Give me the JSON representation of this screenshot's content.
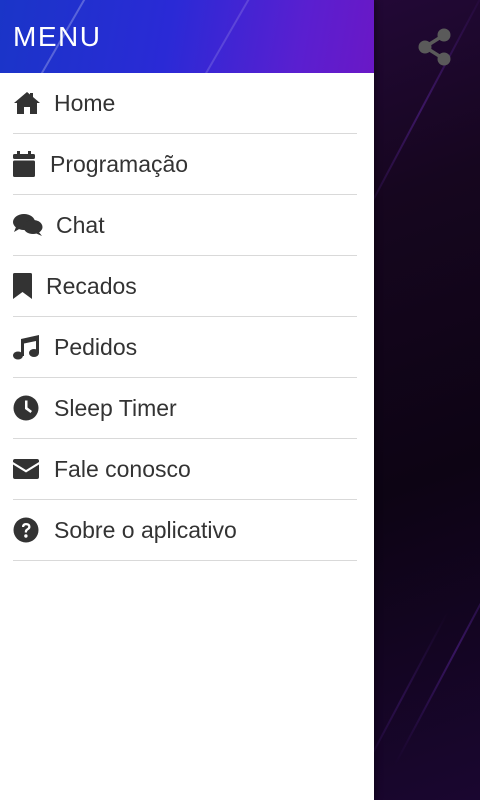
{
  "drawer": {
    "title": "MENU",
    "items": [
      {
        "label": "Home",
        "icon": "home-icon"
      },
      {
        "label": "Programação",
        "icon": "calendar-icon"
      },
      {
        "label": "Chat",
        "icon": "chat-icon"
      },
      {
        "label": "Recados",
        "icon": "bookmark-icon"
      },
      {
        "label": "Pedidos",
        "icon": "music-note-icon"
      },
      {
        "label": "Sleep Timer",
        "icon": "clock-icon"
      },
      {
        "label": "Fale conosco",
        "icon": "envelope-icon"
      },
      {
        "label": "Sobre o aplicativo",
        "icon": "question-circle-icon"
      }
    ]
  },
  "share": {
    "icon": "share-icon"
  },
  "colors": {
    "header_start": "#1a35c8",
    "header_end": "#6a18c6",
    "icon": "#333333",
    "text": "#333333",
    "divider": "#d9d9d9",
    "background": "#14051f",
    "share_icon": "#5a5a5a"
  }
}
